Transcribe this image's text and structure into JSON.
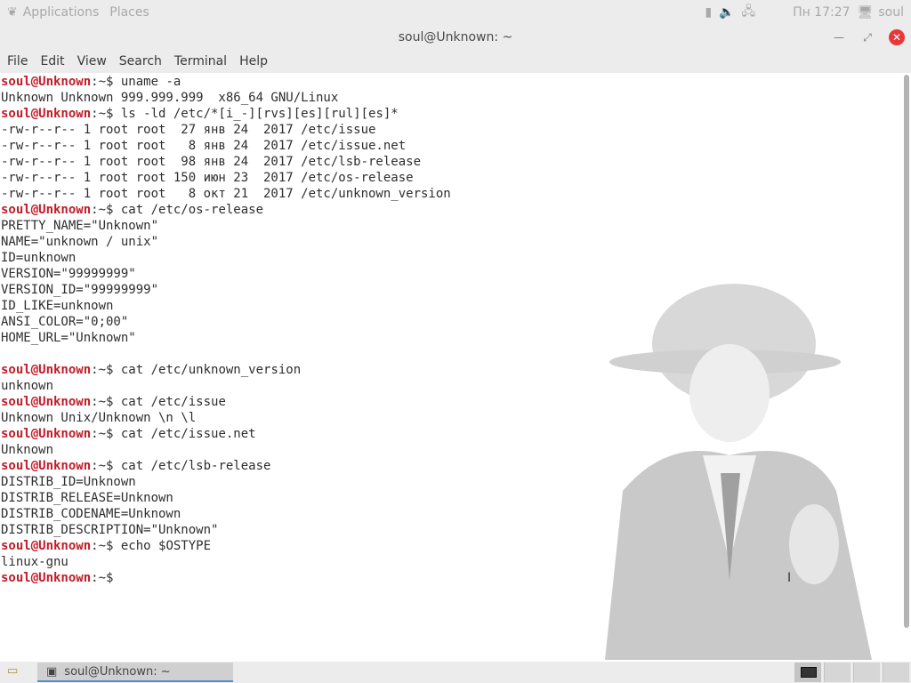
{
  "topbar": {
    "applications": "Applications",
    "places": "Places",
    "clock": "Пн 17:27",
    "user": "soul"
  },
  "window": {
    "title": "soul@Unknown: ~"
  },
  "menu": [
    "File",
    "Edit",
    "View",
    "Search",
    "Terminal",
    "Help"
  ],
  "terminal": {
    "user": "soul@Unknown",
    "lines": [
      {
        "t": "p",
        "cmd": "uname -a"
      },
      {
        "t": "o",
        "text": "Unknown Unknown 999.999.999  x86_64 GNU/Linux"
      },
      {
        "t": "p",
        "cmd": "ls -ld /etc/*[i_-][rvs][es][rul][es]*"
      },
      {
        "t": "o",
        "text": "-rw-r--r-- 1 root root  27 янв 24  2017 /etc/issue"
      },
      {
        "t": "o",
        "text": "-rw-r--r-- 1 root root   8 янв 24  2017 /etc/issue.net"
      },
      {
        "t": "o",
        "text": "-rw-r--r-- 1 root root  98 янв 24  2017 /etc/lsb-release"
      },
      {
        "t": "o",
        "text": "-rw-r--r-- 1 root root 150 июн 23  2017 /etc/os-release"
      },
      {
        "t": "o",
        "text": "-rw-r--r-- 1 root root   8 окт 21  2017 /etc/unknown_version"
      },
      {
        "t": "p",
        "cmd": "cat /etc/os-release"
      },
      {
        "t": "o",
        "text": "PRETTY_NAME=\"Unknown\""
      },
      {
        "t": "o",
        "text": "NAME=\"unknown / unix\""
      },
      {
        "t": "o",
        "text": "ID=unknown"
      },
      {
        "t": "o",
        "text": "VERSION=\"99999999\""
      },
      {
        "t": "o",
        "text": "VERSION_ID=\"99999999\""
      },
      {
        "t": "o",
        "text": "ID_LIKE=unknown"
      },
      {
        "t": "o",
        "text": "ANSI_COLOR=\"0;00\""
      },
      {
        "t": "o",
        "text": "HOME_URL=\"Unknown\""
      },
      {
        "t": "o",
        "text": ""
      },
      {
        "t": "p",
        "cmd": "cat /etc/unknown_version"
      },
      {
        "t": "o",
        "text": "unknown"
      },
      {
        "t": "p",
        "cmd": "cat /etc/issue"
      },
      {
        "t": "o",
        "text": "Unknown Unix/Unknown \\n \\l"
      },
      {
        "t": "p",
        "cmd": "cat /etc/issue.net"
      },
      {
        "t": "o",
        "text": "Unknown"
      },
      {
        "t": "p",
        "cmd": "cat /etc/lsb-release"
      },
      {
        "t": "o",
        "text": "DISTRIB_ID=Unknown"
      },
      {
        "t": "o",
        "text": "DISTRIB_RELEASE=Unknown"
      },
      {
        "t": "o",
        "text": "DISTRIB_CODENAME=Unknown"
      },
      {
        "t": "o",
        "text": "DISTRIB_DESCRIPTION=\"Unknown\""
      },
      {
        "t": "p",
        "cmd": "echo $OSTYPE"
      },
      {
        "t": "o",
        "text": "linux-gnu"
      },
      {
        "t": "p",
        "cmd": ""
      }
    ]
  },
  "taskbar": {
    "task": "soul@Unknown: ~"
  }
}
